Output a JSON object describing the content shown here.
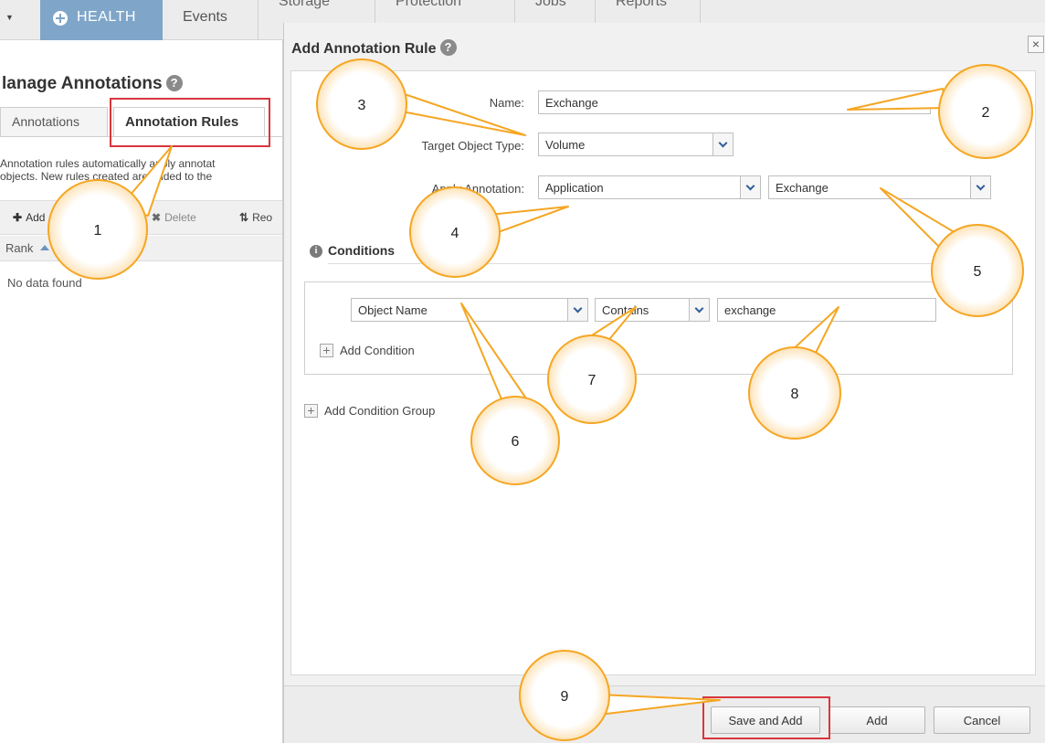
{
  "nav": {
    "health": "HEALTH",
    "tabs": [
      {
        "label": "Events"
      },
      {
        "label": "Storage"
      },
      {
        "label": "Protection"
      },
      {
        "label": "Jobs"
      },
      {
        "label": "Reports"
      }
    ]
  },
  "left": {
    "title": "lanage Annotations",
    "tabs": {
      "annotations": "Annotations",
      "rules": "Annotation Rules"
    },
    "desc_line1": "Annotation rules automatically apply annotat",
    "desc_line2": "objects. New rules created are added to the",
    "toolbar": {
      "add": "Add",
      "delete": "Delete",
      "reorder": "Reo"
    },
    "column": "Rank",
    "empty": "No data found"
  },
  "dialog": {
    "title": "Add Annotation Rule",
    "close": "×",
    "name_label": "Name:",
    "name_value": "Exchange",
    "target_label": "Target Object Type:",
    "target_value": "Volume",
    "apply_label": "Apply Annotation:",
    "apply_annotation": "Application",
    "apply_value": "Exchange",
    "conditions_title": "Conditions",
    "condition": {
      "field": "Object Name",
      "operator": "Contains",
      "value": "exchange"
    },
    "add_condition": "Add Condition",
    "add_condition_group": "Add Condition Group",
    "buttons": {
      "save_and_add": "Save and Add",
      "add": "Add",
      "cancel": "Cancel"
    }
  },
  "callouts": [
    "1",
    "2",
    "3",
    "4",
    "5",
    "6",
    "7",
    "8",
    "9"
  ],
  "colors": {
    "callout_fill": "#ffffff",
    "callout_stroke": "#f5a623",
    "highlight": "#d9363e",
    "health_tab": "#7fa6c9",
    "chevron": "#2f5f9a"
  }
}
